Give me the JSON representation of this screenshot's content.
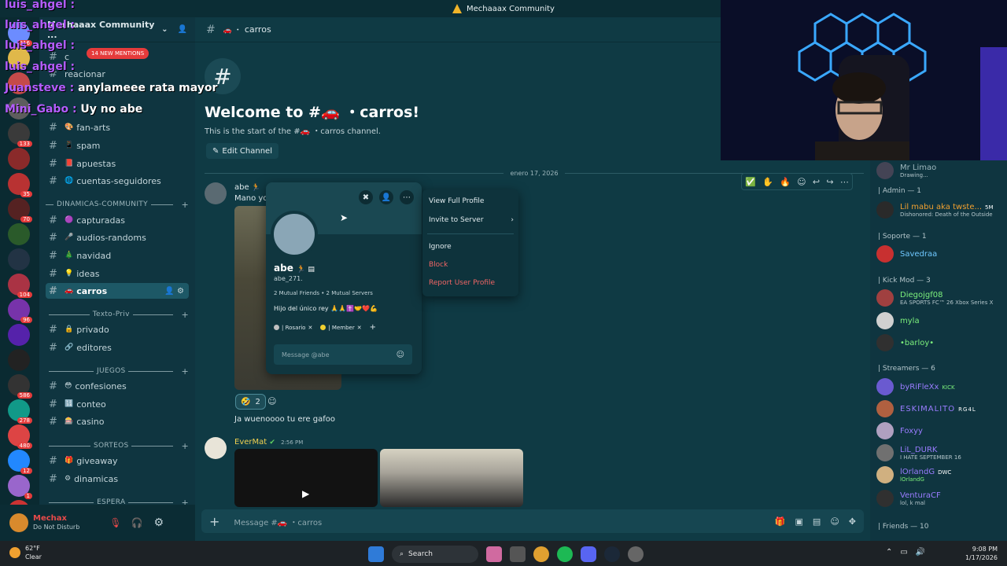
{
  "title_bar": {
    "text": "Mechaaax Community"
  },
  "chat_overlay": {
    "lines": [
      {
        "text": "luis_ahgel :",
        "color": "#b45dff"
      },
      {
        "text": "luis_ahgel :",
        "color": "#b45dff"
      },
      {
        "text": "luis_ahgel :",
        "color": "#b45dff"
      },
      {
        "text": "luis_ahgel :",
        "color": "#b45dff"
      },
      {
        "text": "Juansteve : anylameee rata mayor",
        "color": "#b45dff"
      },
      {
        "text": "Mini_Gabo : Uy no abe",
        "color": "#b45dff"
      }
    ],
    "new_mentions": "14 NEW MENTIONS"
  },
  "server_rail": {
    "badges": [
      "316",
      "",
      "",
      "",
      "133",
      "",
      "35",
      "70",
      "",
      "",
      "104",
      "96",
      "",
      "",
      "586",
      "278",
      "480",
      "12",
      "1",
      "NEW"
    ],
    "colors": [
      "#6c8cff",
      "#e0b84a",
      "#c54a4a",
      "#5d5d5d",
      "#3a3a3a",
      "#8a2a2a",
      "#b83232",
      "#552222",
      "#2a5a2a",
      "#223344",
      "#aa3344",
      "#7733aa",
      "#5522aa",
      "#222222",
      "#333333",
      "#119988",
      "#dd4444",
      "#2288ff",
      "#9966cc",
      "#cc3333"
    ]
  },
  "sidebar": {
    "server_name": "Mechaaax Community ...",
    "channels_top": [
      {
        "label": "c",
        "emoji": ""
      },
      {
        "label": "reacionar",
        "emoji": ""
      }
    ],
    "channels": [
      {
        "label": "fan-arts",
        "emoji": "🎨"
      },
      {
        "label": "spam",
        "emoji": "📱"
      },
      {
        "label": "apuestas",
        "emoji": "📕"
      },
      {
        "label": "cuentas-seguidores",
        "emoji": "🌐"
      }
    ],
    "categories": {
      "dinamicas": "DINAMICAS-COMMUNITY",
      "texto": "Texto-Priv",
      "juegos": "JUEGOS",
      "sorteos": "SORTEOS",
      "espera": "ESPERA"
    },
    "dinamicas_channels": [
      {
        "label": "capturadas",
        "emoji": "🟣"
      },
      {
        "label": "audios-randoms",
        "emoji": "🎤"
      },
      {
        "label": "navidad",
        "emoji": "🎄"
      },
      {
        "label": "ideas",
        "emoji": "💡"
      },
      {
        "label": "carros",
        "emoji": "🚗"
      }
    ],
    "texto_channels": [
      {
        "label": "privado",
        "emoji": "🔒"
      },
      {
        "label": "editores",
        "emoji": "🔗"
      }
    ],
    "juegos_channels": [
      {
        "label": "confesiones",
        "emoji": "😳"
      },
      {
        "label": "conteo",
        "emoji": "🔢"
      },
      {
        "label": "casino",
        "emoji": "🎰"
      }
    ],
    "sorteos_channels": [
      {
        "label": "giveaway",
        "emoji": "🎁"
      },
      {
        "label": "dinamicas",
        "emoji": "⚙"
      }
    ]
  },
  "user_panel": {
    "name": "Mechax",
    "status": "Do Not Disturb"
  },
  "topbar": {
    "channel": "carros"
  },
  "welcome": {
    "title": "Welcome to #🚗 ・carros!",
    "subtitle": "This is the start of the #🚗 ・carros channel.",
    "edit_button": "Edit Channel"
  },
  "divider_date": "enero 17, 2026",
  "messages": [
    {
      "author": "abe",
      "text": "Mano yo",
      "author_color": "#dbe6ea"
    },
    {
      "reaction_count": "2",
      "text": "Ja wuenoooo tu ere gafoo"
    },
    {
      "author": "EverMat",
      "time": "2:56 PM",
      "author_color": "#f0d050"
    }
  ],
  "composer": {
    "placeholder": "Message #🚗 ・carros"
  },
  "profile_popup": {
    "display_name": "abe",
    "username": "abe_271.",
    "mutual": "2 Mutual Friends • 2 Mutual Servers",
    "bio": "Hijo del único rey",
    "roles": [
      {
        "label": "| Rosario",
        "color": "#c0c0c0"
      },
      {
        "label": "| Member",
        "color": "#f0d030"
      }
    ],
    "message_placeholder": "Message @abe"
  },
  "context_menu": {
    "items": [
      {
        "label": "View Full Profile",
        "danger": false
      },
      {
        "label": "Invite to Server",
        "danger": false
      },
      {
        "label": "Ignore",
        "danger": false
      },
      {
        "label": "Block",
        "danger": true
      },
      {
        "label": "Report User Profile",
        "danger": true
      }
    ]
  },
  "members": {
    "top_partial": {
      "name": "Mr Limao",
      "status": "Drawing..."
    },
    "groups": [
      {
        "title": "| Admin — 1"
      },
      {
        "title": "| Soporte — 1"
      },
      {
        "title": "| Kick Mod — 3"
      },
      {
        "title": "| Streamers — 6"
      },
      {
        "title": "| Friends — 10"
      }
    ],
    "list": [
      {
        "name": "Lil mabu aka twste...",
        "status": "Dishonored: Death of the Outside",
        "color": "#f0a030",
        "tag": "5M"
      },
      {
        "name": "Savedraa",
        "status": "",
        "color": "#6fc8ff",
        "tag": ""
      },
      {
        "name": "Diegojgf08",
        "status": "EA SPORTS FC™ 26 Xbox Series X",
        "color": "#7cf07c",
        "tag": ""
      },
      {
        "name": "myla",
        "status": "",
        "color": "#7cf07c",
        "tag": ""
      },
      {
        "name": "•barloy•",
        "status": "",
        "color": "#7cf07c",
        "tag": ""
      },
      {
        "name": "byRiFleXx",
        "status": "",
        "color": "#9a7cff",
        "tag": "KICK"
      },
      {
        "name": "ESKIMALITO",
        "status": "",
        "color": "#9a7cff",
        "tag": "RG4L"
      },
      {
        "name": "Foxyy",
        "status": "",
        "color": "#9a7cff",
        "tag": ""
      },
      {
        "name": "LiL_DURK",
        "status": "I HATE SEPTEMBER 16",
        "color": "#9a7cff",
        "tag": ""
      },
      {
        "name": "lOrlandG",
        "status": "lOrlandG",
        "color": "#9a7cff",
        "tag": "DWC"
      },
      {
        "name": "VenturaCF",
        "status": "lol, k mal",
        "color": "#9a7cff",
        "tag": ""
      }
    ]
  },
  "taskbar": {
    "weather_temp": "62°F",
    "weather_desc": "Clear",
    "search": "Search",
    "time": "9:08 PM",
    "date": "1/17/2026"
  }
}
